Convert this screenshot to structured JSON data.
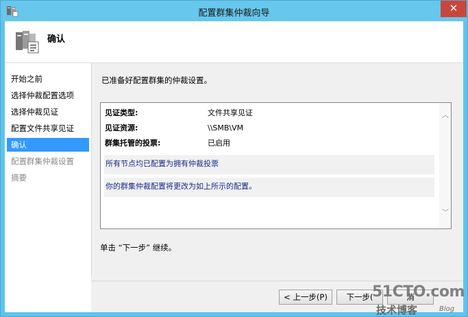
{
  "window": {
    "title": "配置群集仲裁向导"
  },
  "header": {
    "title": "确认"
  },
  "sidebar": {
    "items": [
      {
        "label": "开始之前",
        "state": "normal"
      },
      {
        "label": "选择仲裁配置选项",
        "state": "normal"
      },
      {
        "label": "选择仲裁见证",
        "state": "normal"
      },
      {
        "label": "配置文件共享见证",
        "state": "normal"
      },
      {
        "label": "确认",
        "state": "active"
      },
      {
        "label": "配置群集仲裁设置",
        "state": "disabled"
      },
      {
        "label": "摘要",
        "state": "disabled"
      }
    ]
  },
  "main": {
    "description": "已准备好配置群集的仲裁设置。",
    "details": {
      "rows": [
        {
          "label": "见证类型:",
          "value": "文件共享见证"
        },
        {
          "label": "见证资源:",
          "value": "\\\\SMB\\VM"
        },
        {
          "label": "群集托管的投票:",
          "value": "已启用"
        }
      ],
      "notes": [
        "所有节点均已配置为拥有仲裁投票",
        "你的群集仲裁配置将更改为如上所示的配置。"
      ]
    },
    "continue_text": "单击 “下一步” 继续。"
  },
  "buttons": {
    "back": "< 上一步(P)",
    "next": "下一步(",
    "cancel": "消"
  },
  "watermark": {
    "line1": "51CTO.com",
    "line2": "技术博客",
    "line3": "Blog"
  },
  "colors": {
    "titlebar": "#67c7ec",
    "close": "#c9463d",
    "selected": "#3399ff",
    "note_text": "#1c2a8c"
  },
  "icons": {
    "app": "cluster-app-icon",
    "header": "cluster-servers-icon",
    "close": "close-icon"
  }
}
